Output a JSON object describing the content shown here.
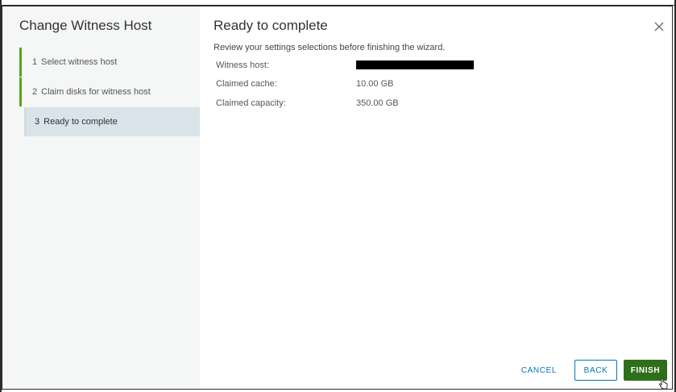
{
  "wizard": {
    "title": "Change Witness Host",
    "steps": [
      {
        "number": "1",
        "label": "Select witness host",
        "state": "done"
      },
      {
        "number": "2",
        "label": "Claim disks for witness host",
        "state": "done"
      },
      {
        "number": "3",
        "label": "Ready to complete",
        "state": "active"
      }
    ]
  },
  "main": {
    "title": "Ready to complete",
    "subtitle": "Review your settings selections before finishing the wizard.",
    "close_icon": "close-icon",
    "summary": [
      {
        "label": "Witness host:",
        "value": "",
        "redacted": true
      },
      {
        "label": "Claimed cache:",
        "value": "10.00 GB"
      },
      {
        "label": "Claimed capacity:",
        "value": "350.00 GB"
      }
    ]
  },
  "footer": {
    "cancel_label": "CANCEL",
    "back_label": "BACK",
    "finish_label": "FINISH"
  },
  "colors": {
    "accent": "#0079b8",
    "primary_button": "#2f6f1c",
    "step_done": "#5aa220",
    "active_step_bg": "#d9e4ea",
    "sidebar_bg": "#f5f6f6"
  }
}
